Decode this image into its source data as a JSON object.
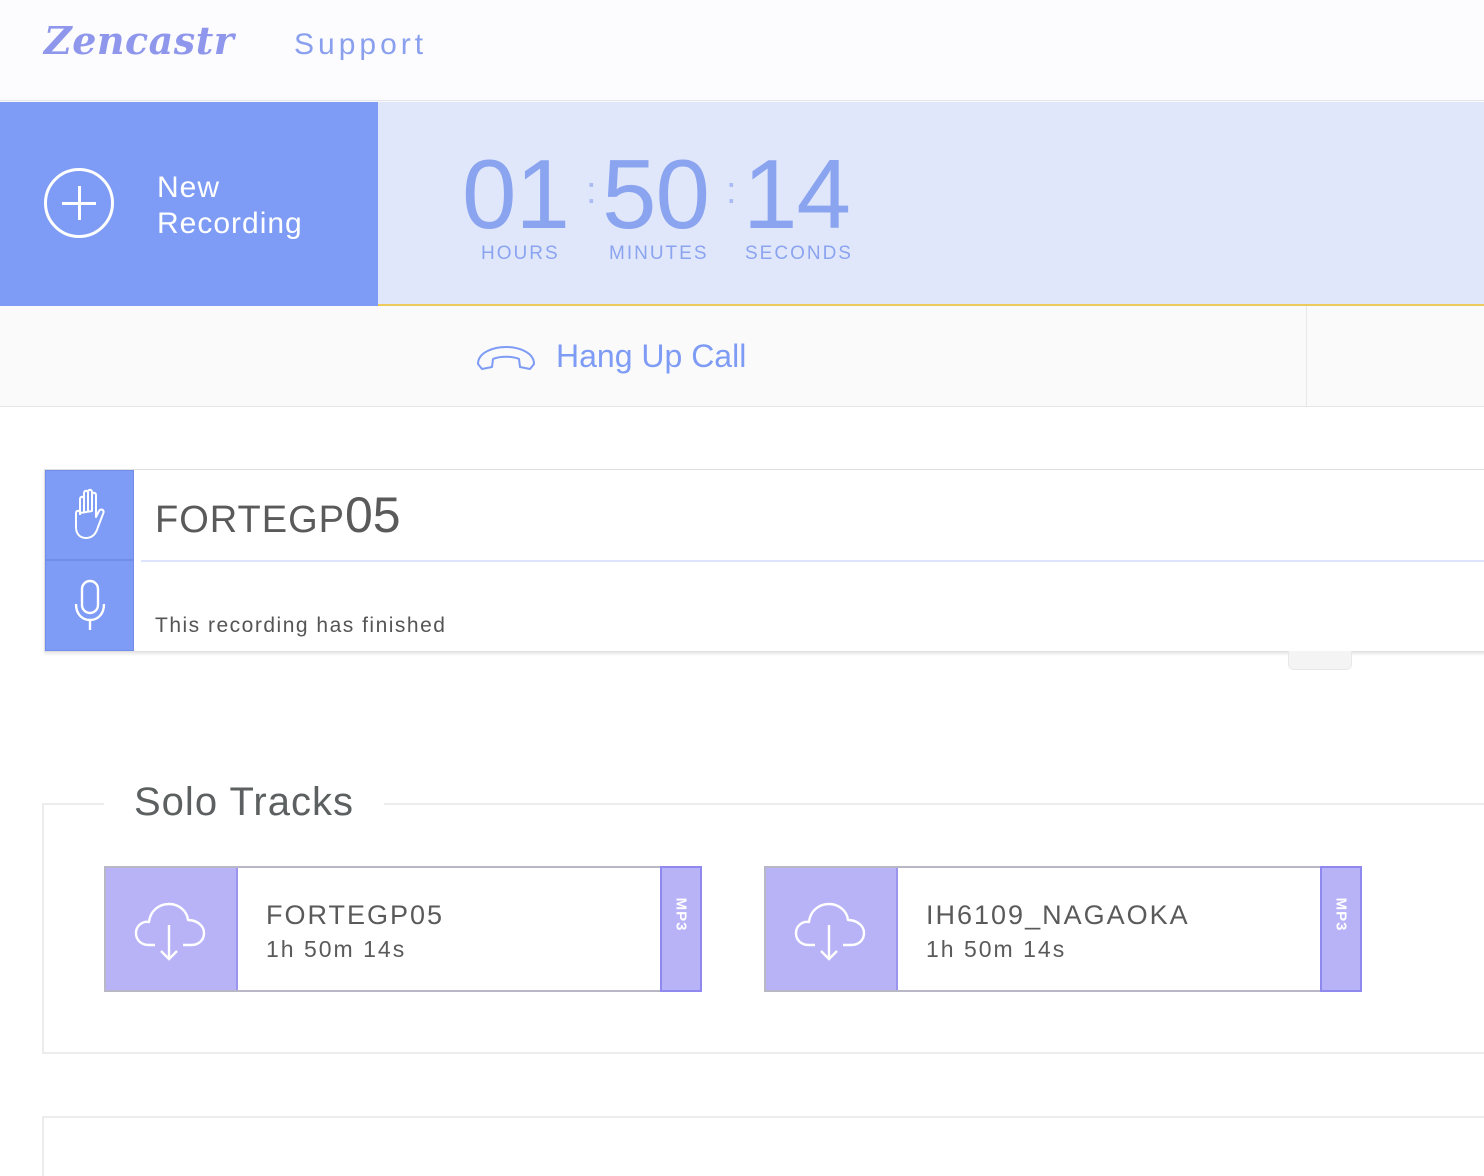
{
  "nav": {
    "logo": "Zencastr",
    "support": "Support"
  },
  "new_recording": {
    "label_line1": "New",
    "label_line2": "Recording",
    "icon": "plus-circle-icon"
  },
  "timer": {
    "hours": "01",
    "minutes": "50",
    "seconds": "14",
    "hours_label": "HOURS",
    "minutes_label": "MINUTES",
    "seconds_label": "SECONDS"
  },
  "call": {
    "hang_up_label": "Hang Up Call",
    "icon": "phone-hangup-icon"
  },
  "recording": {
    "name_prefix": "FORTEGP",
    "name_number": "05",
    "status": "This recording has finished",
    "icons": [
      "hand-icon",
      "microphone-icon"
    ]
  },
  "solo_tracks": {
    "title": "Solo Tracks",
    "tracks": [
      {
        "name": "FORTEGP05",
        "duration": "1h 50m 14s",
        "format": "MP3",
        "icon": "cloud-download-icon"
      },
      {
        "name": "IH6109_NAGAOKA",
        "duration": "1h 50m 14s",
        "format": "MP3",
        "icon": "cloud-download-icon"
      }
    ]
  },
  "colors": {
    "accent": "#7e9bf5",
    "timer_bg": "#e1e7fb",
    "track_accent": "#b8b3f7",
    "highlight": "#eccb5c"
  }
}
